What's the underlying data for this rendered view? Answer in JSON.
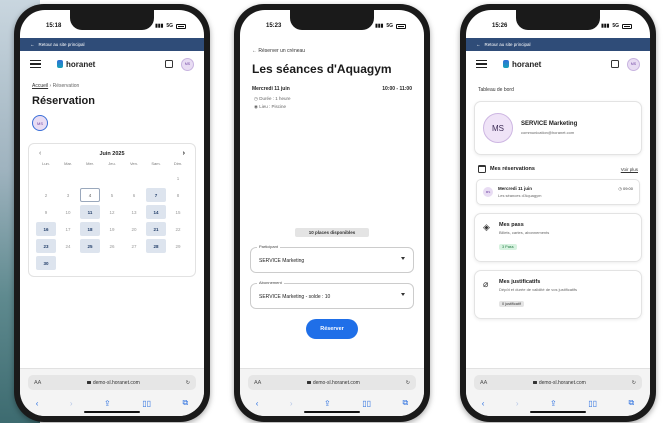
{
  "common": {
    "back_to_site": "Retour au site principal",
    "brand": "horanet",
    "initials_small": "MS",
    "url": "demo-sl.horanet.com",
    "aa": "AA"
  },
  "phone1": {
    "time": "15:18",
    "network": "5G",
    "breadcrumb_home": "Accueil",
    "breadcrumb_sep": "›",
    "breadcrumb_current": "Réservation",
    "title": "Réservation",
    "calendar": {
      "month": "Juin 2025",
      "prev": "‹",
      "next": "›",
      "weekdays": [
        "Lun.",
        "Mar.",
        "Mer.",
        "Jeu.",
        "Ven.",
        "Sam.",
        "Dim."
      ],
      "days": [
        "",
        "",
        "",
        "",
        "",
        "",
        "1",
        "2",
        "3",
        "4",
        "5",
        "6",
        "7",
        "8",
        "9",
        "10",
        "11",
        "12",
        "13",
        "14",
        "15",
        "16",
        "17",
        "18",
        "19",
        "20",
        "21",
        "22",
        "23",
        "24",
        "25",
        "26",
        "27",
        "28",
        "29",
        "30",
        "",
        "",
        "",
        "",
        "",
        ""
      ],
      "available": [
        "7",
        "11",
        "14",
        "16",
        "18",
        "21",
        "23",
        "25",
        "28",
        "30"
      ],
      "today": "4"
    }
  },
  "phone2": {
    "time": "15:23",
    "network": "5G",
    "back": "Réserver un créneau",
    "title": "Les séances d'Aquagym",
    "date": "Mercredi 11 juin",
    "time_range": "10:00 - 11:00",
    "duration": "Durée : 1 heure",
    "location": "Lieu : Piscine",
    "places": "10 places disponibles",
    "participant_label": "Participant",
    "participant_value": "SERVICE Marketing",
    "subscription_label": "Abonnement",
    "subscription_value": "SERVICE Marketing - solde : 10",
    "reserve_button": "Réserver"
  },
  "phone3": {
    "time": "15:26",
    "network": "5G",
    "section": "Tableau de bord",
    "user_initials": "MS",
    "user_name": "SERVICE Marketing",
    "user_email": "communication@horanet.com",
    "reservations_title": "Mes réservations",
    "see_all": "Voir plus",
    "res_date": "Mercredi 11 juin",
    "res_time": "09:00",
    "res_name": "Les séances d'Aquagym",
    "passes_title": "Mes pass",
    "passes_desc": "Billets, cartes, abonnements",
    "passes_badge": "3 Pass",
    "proofs_title": "Mes justificatifs",
    "proofs_desc": "Dépôt et durée de validité de vos justificatifs",
    "proofs_badge": "0 justificatif"
  },
  "colors": {
    "backbar": "#2f4c78",
    "primary": "#1f6fe8",
    "available_day": "#dde4ee"
  }
}
